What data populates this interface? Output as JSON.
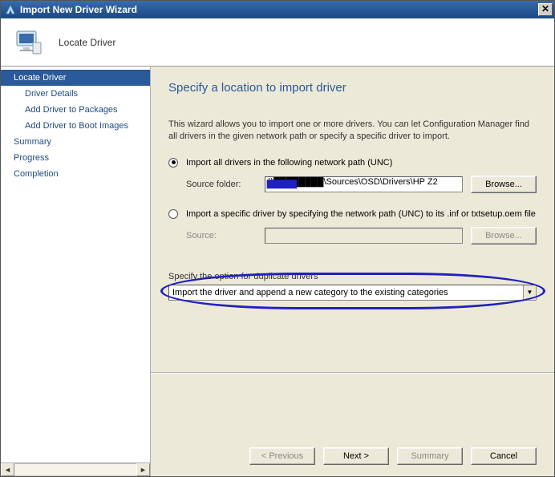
{
  "titlebar": {
    "title": "Import New Driver Wizard"
  },
  "header": {
    "page_name": "Locate Driver"
  },
  "sidebar": {
    "items": [
      {
        "label": "Locate Driver",
        "active": true,
        "sub": false
      },
      {
        "label": "Driver Details",
        "active": false,
        "sub": true
      },
      {
        "label": "Add Driver to Packages",
        "active": false,
        "sub": true
      },
      {
        "label": "Add Driver to Boot Images",
        "active": false,
        "sub": true
      },
      {
        "label": "Summary",
        "active": false,
        "sub": false
      },
      {
        "label": "Progress",
        "active": false,
        "sub": false
      },
      {
        "label": "Completion",
        "active": false,
        "sub": false
      }
    ]
  },
  "main": {
    "heading": "Specify a location to import driver",
    "intro": "This wizard allows you to import one or more drivers. You can let Configuration Manager find all drivers in the given network path or specify a specific driver to import.",
    "radio_all_label": "Import all drivers in the following network path (UNC)",
    "source_folder_label": "Source folder:",
    "source_folder_value": "\\\\████████\\Sources\\OSD\\Drivers\\HP Z2",
    "browse_all_label": "Browse...",
    "radio_specific_label": "Import a specific driver by specifying the network path (UNC) to its .inf or txtsetup.oem file",
    "source_label": "Source:",
    "source_value": "",
    "browse_specific_label": "Browse...",
    "duplicate_group_label": "Specify the option for duplicate drivers",
    "duplicate_selected": "Import the driver and append a new category to the existing categories"
  },
  "buttons": {
    "previous": "< Previous",
    "next": "Next >",
    "summary": "Summary",
    "cancel": "Cancel"
  }
}
